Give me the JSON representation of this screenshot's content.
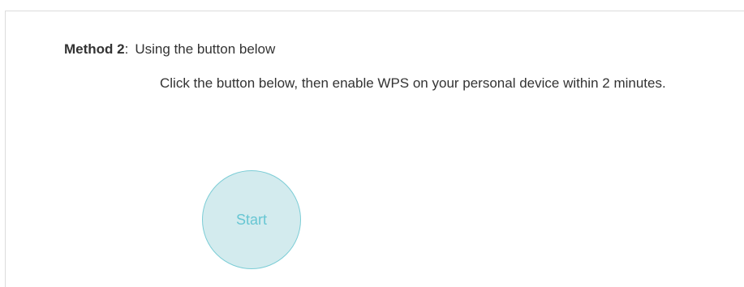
{
  "method": {
    "label": "Method 2",
    "colon": ":",
    "title": "Using the button below",
    "description": "Click the button below, then enable WPS on your personal device within 2 minutes."
  },
  "start_button": {
    "label": "Start"
  },
  "colors": {
    "button_fill": "#d3ebee",
    "button_border": "#7ccdd6",
    "button_text": "#67c6d3"
  }
}
